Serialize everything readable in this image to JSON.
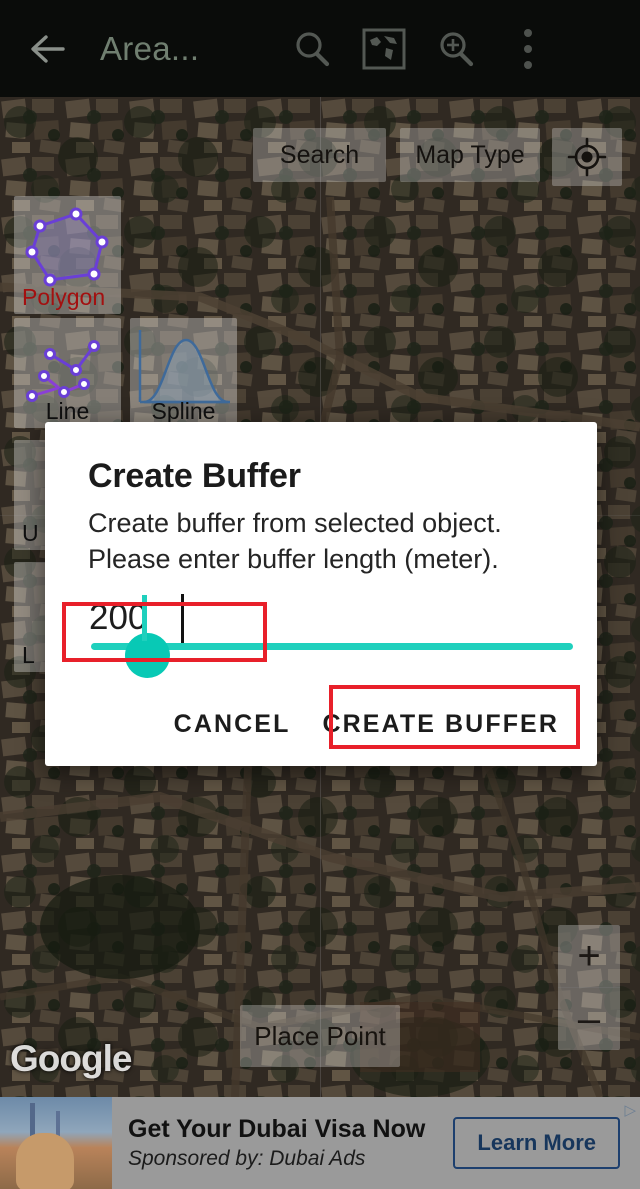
{
  "appbar": {
    "back_icon": "back-arrow-icon",
    "title": "Area...",
    "search_icon": "search-icon",
    "worldmap_icon": "world-map-icon",
    "zoomsearch_icon": "zoom-in-search-icon",
    "overflow_icon": "overflow-menu-icon"
  },
  "map": {
    "top_controls": [
      {
        "label": "Search",
        "name": "map-search-button"
      },
      {
        "label": "Map Type",
        "name": "map-type-button"
      }
    ],
    "gps_icon": "my-location-icon",
    "place_point_label": "Place Point",
    "attribution": "Google",
    "zoom_in": "+",
    "zoom_out": "–"
  },
  "tools": [
    {
      "label": "Polygon",
      "selected": true
    },
    {
      "label": "Line",
      "selected": false
    },
    {
      "label": "Spline",
      "selected": false
    },
    {
      "label": "U",
      "selected": false
    },
    {
      "label": "L",
      "selected": false
    }
  ],
  "dialog": {
    "title": "Create Buffer",
    "body_line1": "Create buffer from selected object.",
    "body_line2": "Please enter buffer length (meter).",
    "input_value": "200",
    "cancel_label": "CANCEL",
    "confirm_label": "CREATE BUFFER",
    "accent_color": "#1fd0bd",
    "annotation_color": "#e8202a"
  },
  "ad": {
    "headline": "Get Your Dubai Visa Now",
    "sponsor": "Sponsored by: Dubai Ads",
    "cta_label": "Learn More",
    "adchoices_icon": "ad-choices-icon"
  }
}
